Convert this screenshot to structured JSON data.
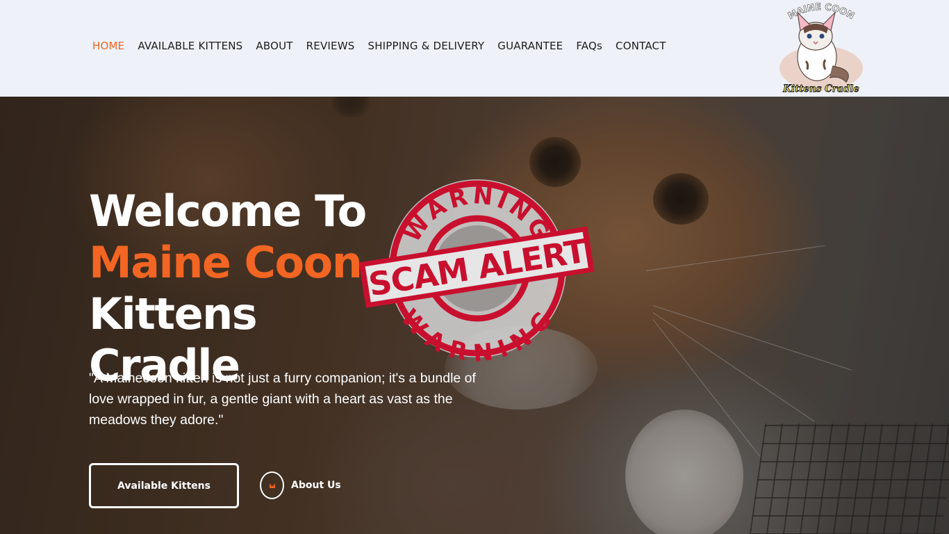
{
  "nav": {
    "items": [
      {
        "label": "HOME",
        "active": true
      },
      {
        "label": "AVAILABLE KITTENS",
        "active": false
      },
      {
        "label": "ABOUT",
        "active": false
      },
      {
        "label": "REVIEWS",
        "active": false
      },
      {
        "label": "SHIPPING & DELIVERY",
        "active": false
      },
      {
        "label": "GUARANTEE",
        "active": false
      },
      {
        "label": "FAQs",
        "active": false
      },
      {
        "label": "CONTACT",
        "active": false
      }
    ]
  },
  "logo": {
    "top_text": "MAINE COON",
    "bottom_text": "Kittens Cradle"
  },
  "hero": {
    "title_line1": "Welcome To",
    "title_accent": "Maine Coon",
    "title_rest": " Kittens",
    "title_line3": "Cradle",
    "quote": "\"A Mainecoon kitten is not just a furry companion; it's a bundle of love wrapped in fur, a gentle giant with a heart as vast as the meadows they adore.\"",
    "primary_button": "Available Kittens",
    "secondary_button": "About Us"
  },
  "stamp": {
    "banner": "SCAM ALERT",
    "ring_text_top": "WARNING",
    "ring_text_bottom": "WARNING"
  },
  "colors": {
    "accent": "#f26522",
    "header_bg": "#eef1f8",
    "stamp_red": "#c8102e"
  }
}
